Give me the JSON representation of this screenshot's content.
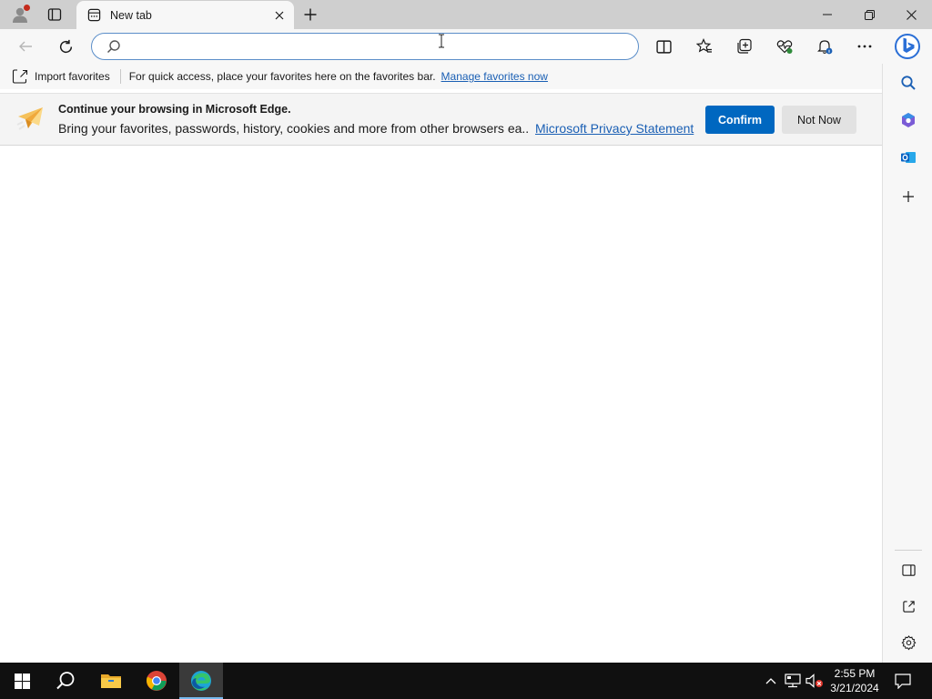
{
  "window": {
    "tab_title": "New tab",
    "tab_icons": {
      "profile": "profile-icon",
      "tab_actions": "tab-actions-icon",
      "tab_favicon": "new-tab-page-icon",
      "close_tab": "close-icon",
      "new_tab": "plus-icon"
    },
    "controls": {
      "minimize": "minimize-icon",
      "restore": "restore-icon",
      "close": "close-icon"
    }
  },
  "toolbar": {
    "address_value": "",
    "address_placeholder": "",
    "buttons": [
      "back-icon",
      "refresh-icon",
      "split-screen-icon",
      "favorites-icon",
      "collections-icon",
      "browser-essentials-icon",
      "notifications-icon",
      "more-icon",
      "copilot-icon"
    ]
  },
  "favorites_bar": {
    "import_label": "Import favorites",
    "hint": "For quick access, place your favorites here on the favorites bar.",
    "manage_link": "Manage favorites now"
  },
  "infobar": {
    "title": "Continue your browsing in Microsoft Edge.",
    "description": "Bring your favorites, passwords, history, cookies and more from other browsers ea...",
    "privacy_link": "Microsoft Privacy Statement",
    "confirm_label": "Confirm",
    "not_now_label": "Not Now"
  },
  "sidebar": {
    "top_items": [
      "search-icon",
      "copilot-apps-icon",
      "outlook-icon",
      "add-icon"
    ],
    "bottom_items": [
      "hide-sidebar-icon",
      "open-external-icon",
      "settings-icon"
    ]
  },
  "taskbar": {
    "apps": [
      "windows-start-icon",
      "search-icon",
      "file-explorer-icon",
      "chrome-icon",
      "edge-icon"
    ],
    "active_app": "edge-icon",
    "tray": [
      "chevron-up-icon",
      "network-icon",
      "volume-muted-icon"
    ],
    "time": "2:55 PM",
    "date": "3/21/2024"
  },
  "colors": {
    "accent": "#0067c0",
    "link": "#1a5fb4",
    "taskbar": "#101010",
    "tab_strip": "#cfcfcf"
  }
}
